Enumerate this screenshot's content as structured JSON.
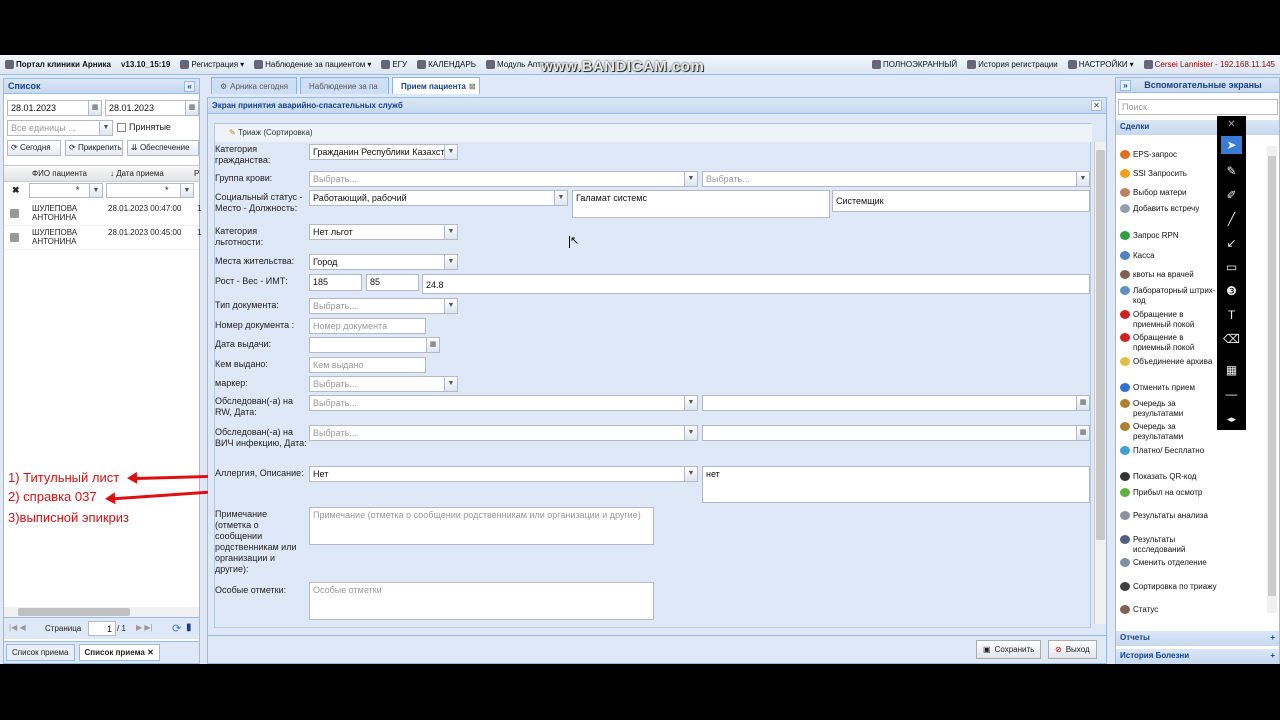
{
  "watermark": "www.BANDICAM.com",
  "topbar": {
    "app_title": "Портал клиники Арника",
    "version": "v13.10_15:19",
    "items": [
      "Регистрация",
      "Наблюдение за пациентом",
      "ЕГУ",
      "КАЛЕНДАРЬ",
      "Модуль Аптека"
    ],
    "right_items": [
      "ПОЛНОЭКРАННЫЙ",
      "История регистрации",
      "НАСТРОЙКИ",
      "Cersei Lannister - 192.168.11.145"
    ]
  },
  "left": {
    "title": "Список",
    "date_from": "28.01.2023",
    "date_to": "28.01.2023",
    "unit_placeholder": "Все единицы ...",
    "accepted_label": "Принятые",
    "btn_today": "Сегодня",
    "btn_attach": "Прикрепить",
    "btn_provision": "Обеспечение",
    "col_fio": "ФИО пациента",
    "col_date": "Дата приема",
    "filter_star": "*",
    "rows": [
      {
        "name": "ШУЛЕПОВА АНТОНИНА",
        "date": "28.01.2023 00:47:00",
        "extra": "1"
      },
      {
        "name": "ШУЛЕПОВА АНТОНИНА",
        "date": "28.01.2023 00:45:00",
        "extra": "1"
      }
    ],
    "page_label": "Страница",
    "page_value": "1",
    "page_total": "/ 1",
    "tab1": "Список приема",
    "tab2": "Список приема"
  },
  "tabs": [
    "Арника сегодня",
    "Наблюдение за па",
    "Прием пациента"
  ],
  "center": {
    "title": "Экран принятия аварийно-спасательных служб",
    "fieldset_title": "Триаж (Сортировка)",
    "placeholder_select": "Выбрать...",
    "labels": {
      "citizenship": "Категория гражданства:",
      "blood": "Группа крови:",
      "social": "Социальный статус - Место - Должность:",
      "benefit": "Категория льготности:",
      "residence": "Места жительства:",
      "height_weight": "Рост - Вес - ИМТ:",
      "doc_type": "Тип документа:",
      "doc_number": "Номер документа :",
      "issue_date": "Дата выдачи:",
      "issued_by": "Кем выдано:",
      "marker": "маркер:",
      "rw": "Обследован(-а) на RW, Дата:",
      "hiv": "Обследован(-а) на ВИЧ инфекцию, Дата:",
      "allergy": "Аллергия, Описание:",
      "note": "Примечание (отметка о сообщении родственникам или организации и другие):",
      "special": "Особые отметки:"
    },
    "values": {
      "citizenship": "Гражданин Республики Казахстан",
      "social": "Работающий, рабочий",
      "workplace": "Галамат системс",
      "position": "Системщик",
      "benefit": "Нет льгот",
      "residence": "Город",
      "height": "185",
      "weight": "85",
      "bmi": "24.8",
      "allergy": "Нет",
      "allergy_desc": "нет"
    },
    "placeholders": {
      "doc_number": "Номер документа",
      "issued_by": "Кем выдано",
      "note": "Примечание (отметка о сообщении родственникам или организации и другие)",
      "special": "Особые отметки"
    },
    "btn_save": "Сохранить",
    "btn_exit": "Выход"
  },
  "right": {
    "title": "Вспомогательные экраны",
    "search_placeholder": "Поиск",
    "section_deals": "Сделки",
    "items": [
      "EPS-запрос",
      "SSI Запросить",
      "Выбор матери",
      "Добавить встречу",
      "Запрос RPN",
      "Касса",
      "квоты на врачей",
      "Лабораторный штрих-код",
      "Обращение в приемный покой",
      "Обращение в приемный покой",
      "Объединение архива",
      "Отменить прием",
      "Очередь за результатами",
      "Очередь за результатами",
      "Платно/ Бесплатно",
      "Показать QR-код",
      "Прибыл на осмотр",
      "Результаты анализа",
      "Результаты исследований",
      "Сменить отделение",
      "Сортировка по триажу",
      "Статус"
    ],
    "section_reports": "Отчеты",
    "section_history": "История Болезни"
  },
  "annotations": [
    "1) Титульный лист",
    "2) справка 037",
    "3)выписной эпикриз"
  ],
  "colors": {
    "annotation": "#dd1111",
    "header_text": "#15428b"
  }
}
